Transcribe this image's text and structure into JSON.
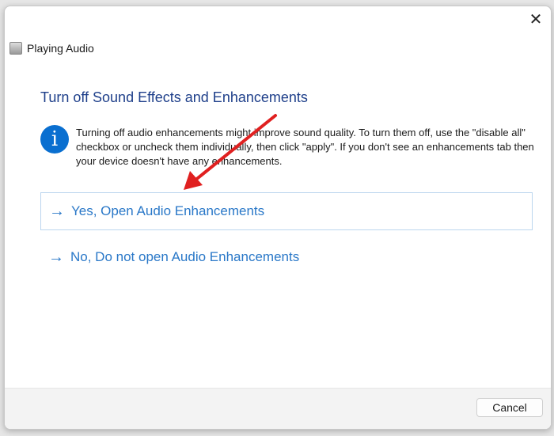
{
  "window": {
    "title": "Playing Audio",
    "close_label": "✕"
  },
  "dialog": {
    "heading": "Turn off Sound Effects and Enhancements",
    "info_icon": "i",
    "info_text": "Turning off audio enhancements might improve sound quality. To turn them off, use the \"disable all\" checkbox or uncheck them individually, then click \"apply\". If you don't see an enhancements tab then your device doesn't have any enhancements.",
    "options": [
      {
        "arrow": "→",
        "label": "Yes, Open Audio Enhancements"
      },
      {
        "arrow": "→",
        "label": "No, Do not open Audio Enhancements"
      }
    ]
  },
  "footer": {
    "cancel_label": "Cancel"
  },
  "annotation": {
    "color": "#e02020"
  }
}
